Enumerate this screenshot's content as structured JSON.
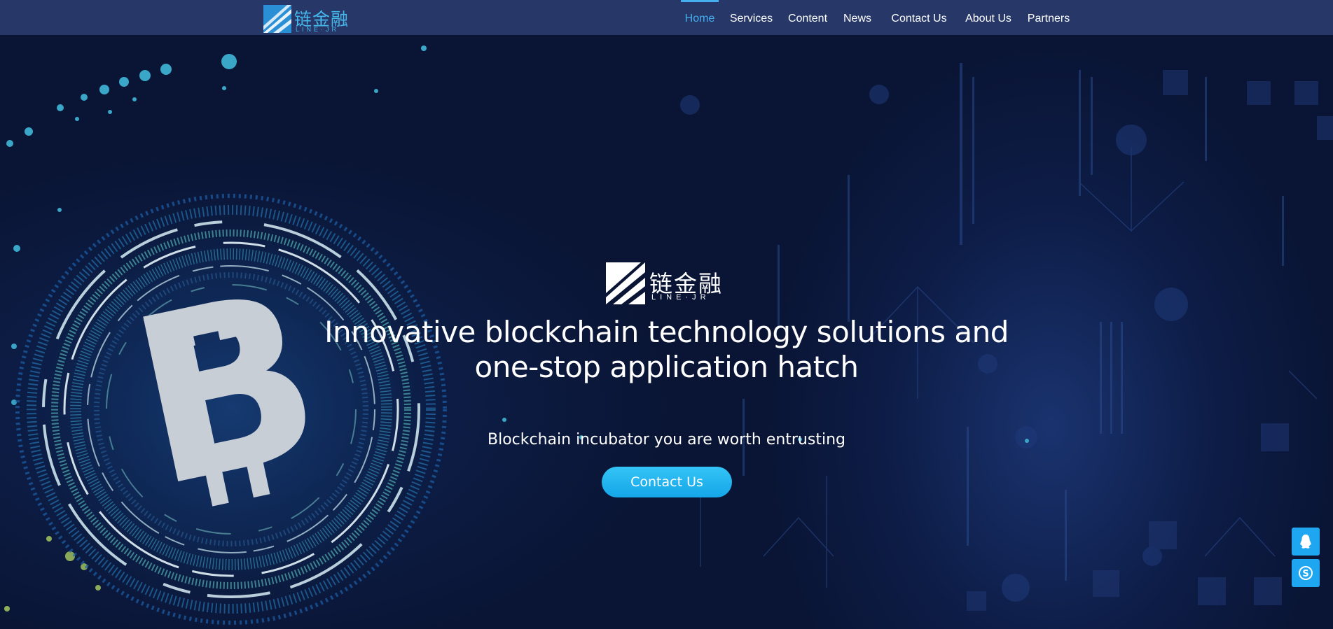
{
  "header": {
    "logo": {
      "chinese": "链金融",
      "english": "LINE·JR"
    },
    "nav": [
      {
        "label": "Home",
        "active": true
      },
      {
        "label": "Services",
        "active": false
      },
      {
        "label": "Content",
        "active": false
      },
      {
        "label": "News",
        "active": false
      },
      {
        "label": "Contact Us",
        "active": false
      },
      {
        "label": "About Us",
        "active": false
      },
      {
        "label": "Partners",
        "active": false
      }
    ]
  },
  "hero": {
    "logo": {
      "chinese": "链金融",
      "english": "LINE·JR"
    },
    "headline_line1": "Innovative blockchain technology solutions and",
    "headline_line2": "one-stop application hatch",
    "subheadline": "Blockchain incubator you are worth entrusting",
    "cta_label": "Contact Us",
    "background_icon": "bitcoin-icon"
  },
  "floating_buttons": [
    {
      "icon": "qq-icon"
    },
    {
      "icon": "skype-icon"
    }
  ],
  "colors": {
    "header_bg": "#263768",
    "page_bg": "#0a1535",
    "accent": "#46aef0",
    "cta_bg": "#1ea6f0",
    "logo_blue": "#46b7ea"
  }
}
